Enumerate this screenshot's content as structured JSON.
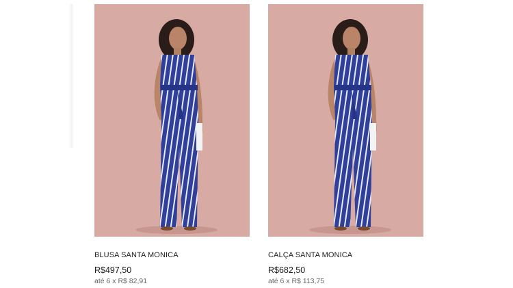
{
  "products": [
    {
      "name": "BLUSA SANTA MONICA",
      "price": "R$497,50",
      "installments": "até 6 x R$ 82,91"
    },
    {
      "name": "CALÇA SANTA MONICA",
      "price": "R$682,50",
      "installments": "até 6 x R$ 113,75"
    }
  ],
  "colors": {
    "image_background": "#d7aaa4",
    "outfit_blue": "#2f3f9a",
    "outfit_stripe": "#e8ecf8"
  }
}
